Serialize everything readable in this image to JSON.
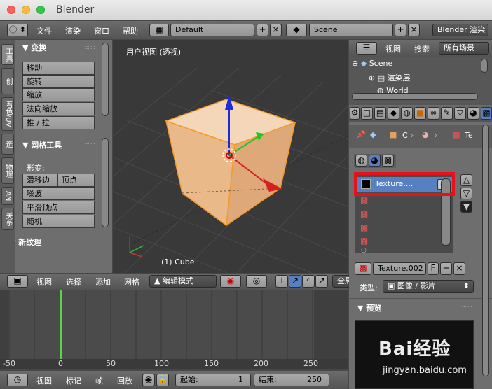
{
  "window": {
    "title": "Blender"
  },
  "topbar": {
    "menus": [
      "文件",
      "渲染",
      "窗口",
      "帮助"
    ],
    "screen_layout": "Default",
    "scene": "Scene",
    "engine": "Blender 渲染"
  },
  "tool_shelf": {
    "tabs": [
      "工具",
      "创",
      "建",
      "着色/UV",
      "选",
      "项",
      "物理",
      "AN",
      "关系"
    ],
    "transform": {
      "title": "变换",
      "ops": [
        "移动",
        "旋转",
        "缩放",
        "法向缩放",
        "推 / 拉"
      ]
    },
    "mesh_tools": {
      "title": "网格工具",
      "deform_label": "形变:",
      "slide_edge": "滑移边",
      "vertex": "顶点",
      "ops": [
        "噪波",
        "平滑顶点",
        "随机"
      ]
    },
    "new_texture": "新纹理"
  },
  "viewport": {
    "view_name": "用户视图 (透视)",
    "object_label": "(1) Cube",
    "header_menus": [
      "视图",
      "选择",
      "添加",
      "网格"
    ],
    "mode": "编辑模式",
    "global": "全局"
  },
  "timeline": {
    "ticks": [
      "-50",
      "0",
      "50",
      "100",
      "150",
      "200",
      "250"
    ],
    "footer_menus": [
      "视图",
      "标记",
      "帧",
      "回放"
    ],
    "start_label": "起始:",
    "start_value": "1",
    "end_label": "结束:",
    "end_value": "250"
  },
  "outliner": {
    "header_menus": [
      "视图",
      "搜索"
    ],
    "filter": "所有场景",
    "items": [
      "Scene",
      "渲染层",
      "World"
    ]
  },
  "properties": {
    "breadcrumb": [
      "C",
      "Te"
    ],
    "texture_slot": "Texture....",
    "texture_name": "Texture.002",
    "fake_user": "F",
    "type_label": "类型:",
    "type_value": "图像 / 影片",
    "preview": "预览"
  },
  "watermark": {
    "brand": "Bai经验",
    "url": "jingyan.baidu.com"
  },
  "colors": {
    "highlight_box": "#e8101a",
    "selected_slot": "#5680c2",
    "cube": "#f1c59c",
    "cube_outline": "#f59a2a"
  }
}
